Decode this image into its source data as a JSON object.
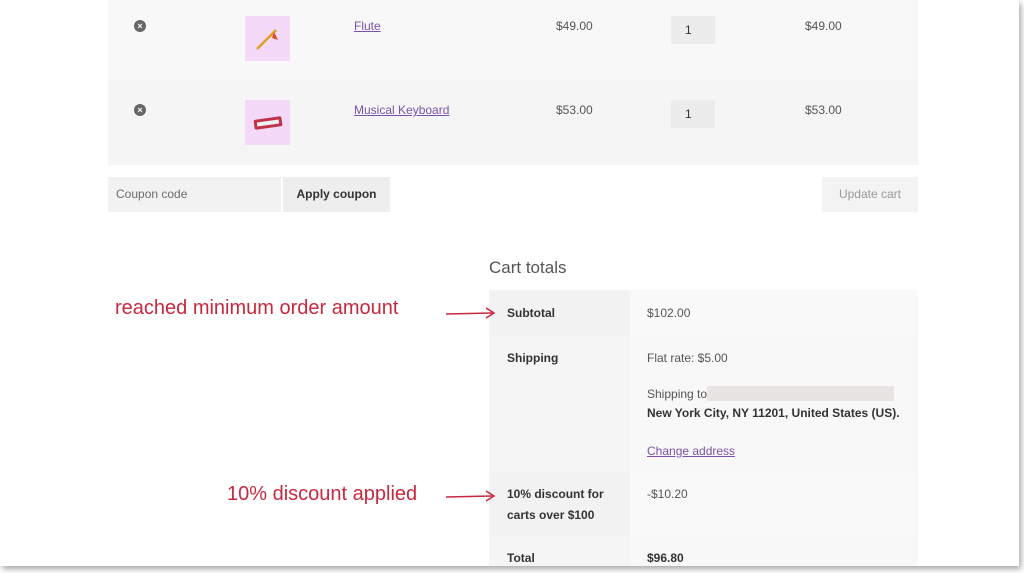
{
  "cart": {
    "items": [
      {
        "remove_icon": "×",
        "name": "Flute",
        "price": "$49.00",
        "quantity": "1",
        "subtotal": "$49.00"
      },
      {
        "remove_icon": "×",
        "name": "Musical Keyboard",
        "price": "$53.00",
        "quantity": "1",
        "subtotal": "$53.00"
      }
    ],
    "coupon_placeholder": "Coupon code",
    "apply_coupon_label": "Apply coupon",
    "update_cart_label": "Update cart"
  },
  "totals": {
    "title": "Cart totals",
    "subtotal_label": "Subtotal",
    "subtotal_value": "$102.00",
    "shipping_label": "Shipping",
    "shipping_rate": "Flat rate: $5.00",
    "shipping_to": "Shipping to",
    "shipping_address": "New York City, NY 11201, United States (US).",
    "change_address": "Change address",
    "discount_label_line1": "10% discount for",
    "discount_label_line2": "carts over $100",
    "discount_value": "-$10.20",
    "total_label": "Total",
    "total_value": "$96.80"
  },
  "annotations": {
    "minimum": "reached minimum order amount",
    "discount": "10% discount applied"
  },
  "colors": {
    "annotation": "#c8283f",
    "link": "#7b52ab"
  }
}
